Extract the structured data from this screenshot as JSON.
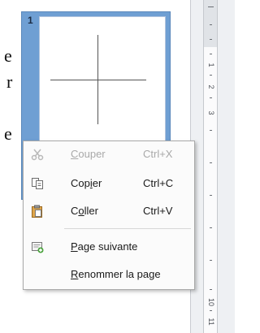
{
  "document": {
    "visible_chars": [
      "e",
      "r",
      "e"
    ]
  },
  "pane": {
    "page_number": "1"
  },
  "ruler": {
    "numbers": [
      "1",
      "2",
      "3",
      "10",
      "11"
    ]
  },
  "menu": {
    "items": [
      {
        "label_pre": "",
        "mnemonic": "C",
        "label_post": "ouper",
        "shortcut": "Ctrl+X",
        "icon": "cut-icon",
        "disabled": true
      },
      {
        "label_pre": "Cop",
        "mnemonic": "i",
        "label_post": "er",
        "shortcut": "Ctrl+C",
        "icon": "copy-icon",
        "disabled": false
      },
      {
        "label_pre": "C",
        "mnemonic": "o",
        "label_post": "ller",
        "shortcut": "Ctrl+V",
        "icon": "paste-icon",
        "disabled": false
      },
      {
        "label_pre": "",
        "mnemonic": "P",
        "label_post": "age suivante",
        "shortcut": "",
        "icon": "new-page-icon",
        "disabled": false
      },
      {
        "label_pre": "",
        "mnemonic": "R",
        "label_post": "enommer la page",
        "shortcut": "",
        "icon": "",
        "disabled": false
      }
    ]
  }
}
